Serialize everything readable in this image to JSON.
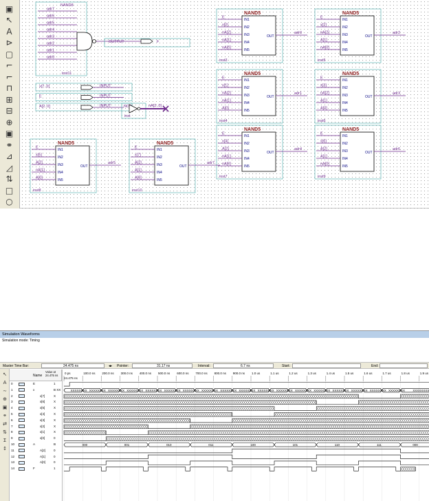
{
  "schematic": {
    "nand8_title": "NAND8",
    "nand8_inputs": [
      "adr7",
      "adr6",
      "adr5",
      "adr4",
      "adr3",
      "adr2",
      "adr1",
      "adr0"
    ],
    "nand8_inst": "inst11",
    "output_label": "OUTPUT",
    "output_net": "F",
    "inputs": [
      {
        "label": "INPUT",
        "net": "x[7..0]"
      },
      {
        "label": "INPUT",
        "net": "E"
      },
      {
        "label": "INPUT",
        "net": "A[2..0]"
      }
    ],
    "not_label": "NOT",
    "not_inst": "inst",
    "not_out_net": "nA[2..0]",
    "nand5_title": "NAND5",
    "nand5_pins": [
      "IN1",
      "IN2",
      "IN3",
      "IN4",
      "IN5"
    ],
    "nand5_out_pin": "OUT",
    "blocks": [
      {
        "inst": "inst3",
        "out": "adr0",
        "ins": [
          "E",
          "x[0]",
          "nA[2]",
          "nA[1]",
          "nA[0]"
        ]
      },
      {
        "inst": "inst5",
        "out": "adr2",
        "ins": [
          "E",
          "x[2]",
          "nA[2]",
          "A[1]",
          "nA[0]"
        ]
      },
      {
        "inst": "inst4",
        "out": "adr1",
        "ins": [
          "E",
          "x[1]",
          "nA[2]",
          "nA[1]",
          "A[0]"
        ]
      },
      {
        "inst": "inst6",
        "out": "adr3",
        "ins": [
          "E",
          "x[3]",
          "nA[2]",
          "A[1]",
          "A[0]"
        ]
      },
      {
        "inst": "inst7",
        "out": "adr4",
        "ins": [
          "E",
          "x[4]",
          "A[2]",
          "nA[1]",
          "nA[0]"
        ]
      },
      {
        "inst": "inst9",
        "out": "adr6",
        "ins": [
          "E",
          "x[6]",
          "A[2]",
          "A[1]",
          "nA[0]"
        ]
      },
      {
        "inst": "inst8",
        "out": "adr5",
        "ins": [
          "E",
          "x[5]",
          "A[2]",
          "nA[1]",
          "A[0]"
        ]
      },
      {
        "inst": "inst10",
        "out": "adr7",
        "ins": [
          "E",
          "x[7]",
          "A[2]",
          "A[1]",
          "A[0]"
        ]
      }
    ],
    "tool_icons": [
      "block-tool-icon",
      "select-arrow-icon",
      "text-tool-icon",
      "symbol-tool-icon",
      "box-tool-icon",
      "orthogonal-node-icon",
      "orthogonal-bus-icon",
      "conduit-icon",
      "rubber-band-icon",
      "partial-line-icon",
      "zoom-icon",
      "full-screen-icon",
      "find-icon",
      "flip-horizontal-icon",
      "flip-vertical-icon",
      "rotate-icon",
      "rectangle-icon",
      "ellipse-icon"
    ]
  },
  "waveform": {
    "title": "Simulation Waveforms",
    "sim_mode": "Simulation mode: Timing",
    "master_time_bar_label": "Master Time Bar:",
    "master_time_bar_value": "24.475 ns",
    "pointer_label": "Pointer:",
    "pointer_value": "31.17 ns",
    "interval_label": "Interval:",
    "interval_value": "6.7 ns",
    "start_label": "Start:",
    "end_label": "End:",
    "name_header": "Name",
    "value_header": "Value at 24.475 ns",
    "cursor_label": "24.475 ns",
    "ticks": [
      "0 ps",
      "100.0 ns",
      "200.0 ns",
      "300.0 ns",
      "400.0 ns",
      "500.0 ns",
      "600.0 ns",
      "700.0 ns",
      "800.0 ns",
      "900.0 ns",
      "1.0 us",
      "1.1 us",
      "1.2 us",
      "1.3 us",
      "1.4 us",
      "1.5 us",
      "1.6 us",
      "1.7 us",
      "1.8 us",
      "1.9 us"
    ],
    "rows": [
      {
        "id": "0",
        "name": "E",
        "value": "1"
      },
      {
        "id": "1",
        "name": "x",
        "value": "B XX"
      },
      {
        "id": "2",
        "name": "x[7]",
        "value": "X"
      },
      {
        "id": "3",
        "name": "x[6]",
        "value": "X"
      },
      {
        "id": "4",
        "name": "x[5]",
        "value": "X"
      },
      {
        "id": "5",
        "name": "x[4]",
        "value": "X"
      },
      {
        "id": "6",
        "name": "x[3]",
        "value": "X"
      },
      {
        "id": "7",
        "name": "x[2]",
        "value": "X"
      },
      {
        "id": "8",
        "name": "x[1]",
        "value": "X"
      },
      {
        "id": "9",
        "name": "x[0]",
        "value": "0"
      },
      {
        "id": "10",
        "name": "A",
        "value": "B"
      },
      {
        "id": "11",
        "name": "A[2]",
        "value": "0"
      },
      {
        "id": "12",
        "name": "A[1]",
        "value": "0"
      },
      {
        "id": "13",
        "name": "A[0]",
        "value": "0"
      },
      {
        "id": "14",
        "name": "F",
        "value": "1"
      }
    ],
    "bus_values": [
      "000",
      "001",
      "010",
      "011",
      "100",
      "101",
      "110",
      "111",
      "000"
    ],
    "xx_label": "XXXXXXXX",
    "tool_icons": [
      "pointer-icon",
      "text-icon",
      "waveform-editing-icon",
      "zoom-icon",
      "full-screen-icon",
      "find-icon",
      "replace-icon",
      "invert-icon",
      "count-value-icon",
      "sort-icon"
    ]
  }
}
